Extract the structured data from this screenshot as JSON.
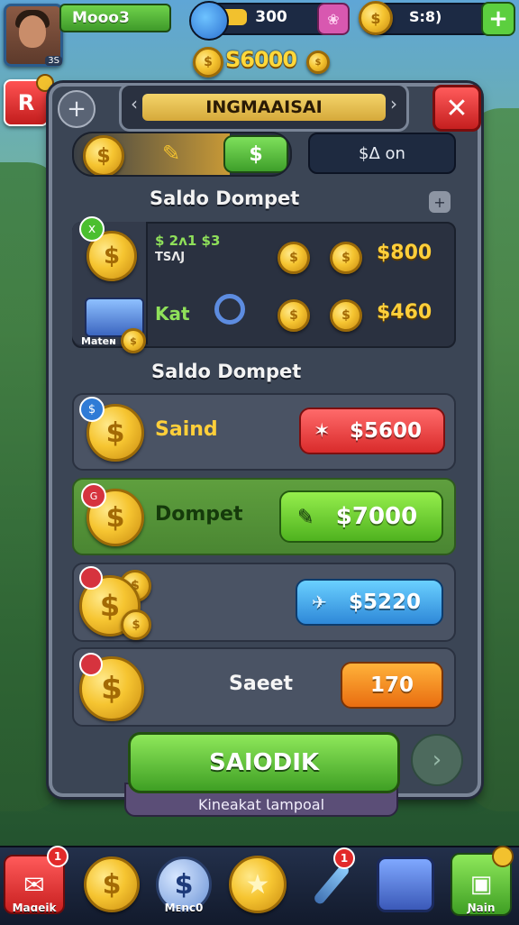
{
  "player": {
    "name": "Mooo3",
    "avatar_tag": "3S"
  },
  "resources": {
    "energy_value": "300",
    "gold_value": "S:8)",
    "total_coins": "S6000"
  },
  "side_button": {
    "label": "R",
    "badge": "•"
  },
  "panel": {
    "title": "INGMAAISAI",
    "money_on": "$ᐃ on",
    "progress": {
      "knob_label": "$",
      "fill_fraction": 0.72
    }
  },
  "wallet": {
    "section_title": "Saldo Dompet",
    "rows": [
      {
        "top_label": "$ 2ᴧ1 $3",
        "sub_label": "TSɅJ",
        "value": "$800",
        "left_badge": "x"
      },
      {
        "top_label": "Kat",
        "sub_label": "",
        "value": "$460",
        "left_caption": "Mateɴ"
      }
    ]
  },
  "offers": {
    "section_title": "Saldo Dompet",
    "items": [
      {
        "label": "Saind",
        "price": "$5600",
        "style": "red",
        "price_icon": "star"
      },
      {
        "label": "Dompet",
        "price": "$7000",
        "style": "green",
        "price_icon": "edit"
      },
      {
        "label": "",
        "price": "$5220",
        "style": "blue",
        "price_icon": "bird"
      },
      {
        "label": "Saeet",
        "price": "170",
        "style": "orange",
        "price_icon": ""
      }
    ]
  },
  "cta": {
    "label": "SAIODIK",
    "sub_label": "Kineakat Ɩampoal"
  },
  "bottom_nav": [
    {
      "label": "Maɑeik",
      "badge": "1"
    },
    {
      "label": "",
      "badge": ""
    },
    {
      "label": "Mᴇnc0",
      "badge": ""
    },
    {
      "label": "",
      "badge": ""
    },
    {
      "label": "",
      "badge": "1"
    },
    {
      "label": "",
      "badge": ""
    },
    {
      "label": "Ɲain",
      "badge": ""
    }
  ],
  "colors": {
    "accent_green": "#5ccf3f",
    "accent_red": "#d92b2b",
    "gold": "#f6c531",
    "panel": "#3b4555"
  }
}
